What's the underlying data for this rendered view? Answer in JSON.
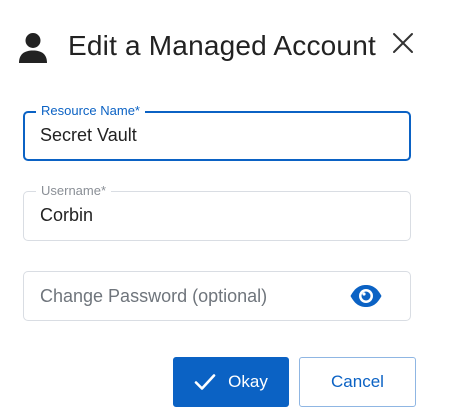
{
  "dialog": {
    "title": "Edit a Managed Account",
    "header_icon": "user-icon",
    "close_icon": "close-icon"
  },
  "fields": {
    "resource_name": {
      "label": "Resource Name*",
      "value": "Secret Vault",
      "focused": true
    },
    "username": {
      "label": "Username*",
      "value": "Corbin"
    },
    "password": {
      "placeholder": "Change Password (optional)",
      "toggle_icon": "eye-icon"
    }
  },
  "actions": {
    "ok_label": "Okay",
    "ok_icon": "check-icon",
    "cancel_label": "Cancel"
  },
  "colors": {
    "accent": "#0b62c4",
    "text": "#222222",
    "muted": "#8a8f96",
    "border": "#d9dde3"
  }
}
